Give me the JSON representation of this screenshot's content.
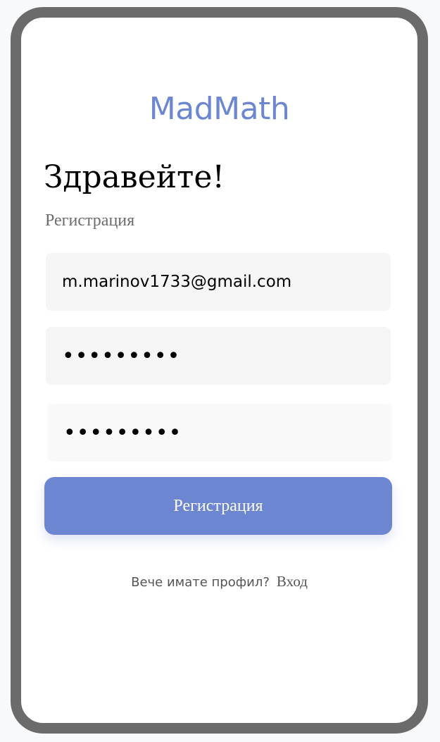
{
  "app": {
    "logo": "MadMath"
  },
  "header": {
    "greeting": "Здравейте!",
    "subtitle": "Регистрация"
  },
  "form": {
    "email_value": "m.marinov1733@gmail.com",
    "password_value": "•••••••••",
    "confirm_password_value": "•••••••••",
    "submit_label": "Регистрация"
  },
  "footer": {
    "prompt": "Вече имате профил?",
    "login_link": "Вход"
  },
  "colors": {
    "accent": "#6c86d1",
    "frame": "#6b6b6b",
    "field_bg": "#f5f5f5"
  }
}
